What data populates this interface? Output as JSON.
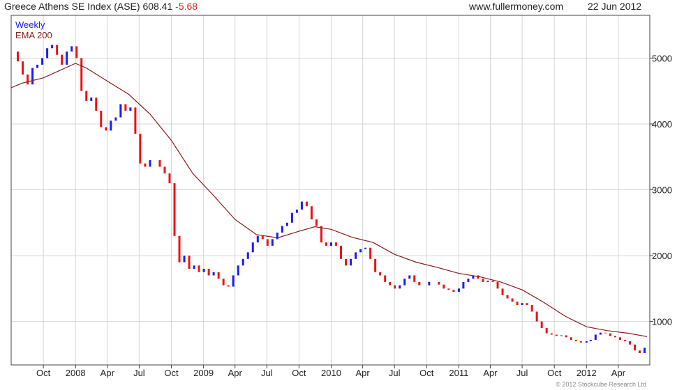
{
  "header": {
    "instrument": "Greece Athens SE Index (ASE)",
    "last": "608.41",
    "change": "-5.68",
    "source": "www.fullermoney.com",
    "date": "22 Jun 2012"
  },
  "copyright": "© 2012 Stockcube Research Ltd",
  "colors": {
    "up": "#1a1aff",
    "down": "#ee1111",
    "ema": "#8b1a1a",
    "grid": "#d6d6d6",
    "border": "#444444"
  },
  "chart_data": {
    "type": "line",
    "subtype": "candlestick-bars",
    "legend": [
      {
        "label": "Weekly",
        "color": "#1a1aff"
      },
      {
        "label": "EMA 200",
        "color": "#8b1a1a"
      }
    ],
    "legend_position": "top-left",
    "grid": true,
    "ylim": [
      340,
      5650
    ],
    "y_ticks": [
      1000,
      2000,
      3000,
      4000,
      5000
    ],
    "x_range": [
      "2007-07-01",
      "2012-06-30"
    ],
    "x_ticks": [
      {
        "label": "Oct",
        "date": "2007-10-01"
      },
      {
        "label": "2008",
        "date": "2008-01-01"
      },
      {
        "label": "Apr",
        "date": "2008-04-01"
      },
      {
        "label": "Jul",
        "date": "2008-07-01"
      },
      {
        "label": "Oct",
        "date": "2008-10-01"
      },
      {
        "label": "2009",
        "date": "2009-01-01"
      },
      {
        "label": "Apr",
        "date": "2009-04-01"
      },
      {
        "label": "Jul",
        "date": "2009-07-01"
      },
      {
        "label": "Oct",
        "date": "2009-10-01"
      },
      {
        "label": "2010",
        "date": "2010-01-01"
      },
      {
        "label": "Apr",
        "date": "2010-04-01"
      },
      {
        "label": "Jul",
        "date": "2010-07-01"
      },
      {
        "label": "Oct",
        "date": "2010-10-01"
      },
      {
        "label": "2011",
        "date": "2011-01-01"
      },
      {
        "label": "Apr",
        "date": "2011-04-01"
      },
      {
        "label": "Jul",
        "date": "2011-07-01"
      },
      {
        "label": "Oct",
        "date": "2011-10-01"
      },
      {
        "label": "2012",
        "date": "2012-01-01"
      },
      {
        "label": "Apr",
        "date": "2012-04-01"
      }
    ],
    "weekly_close": [
      [
        "2007-07-06",
        5100
      ],
      [
        "2007-07-20",
        4950
      ],
      [
        "2007-08-03",
        4750
      ],
      [
        "2007-08-17",
        4600
      ],
      [
        "2007-08-31",
        4850
      ],
      [
        "2007-09-14",
        4900
      ],
      [
        "2007-09-28",
        5000
      ],
      [
        "2007-10-12",
        5150
      ],
      [
        "2007-10-26",
        5200
      ],
      [
        "2007-11-09",
        5050
      ],
      [
        "2007-11-23",
        4900
      ],
      [
        "2007-12-07",
        5100
      ],
      [
        "2007-12-21",
        5180
      ],
      [
        "2008-01-04",
        5000
      ],
      [
        "2008-01-18",
        4500
      ],
      [
        "2008-02-01",
        4350
      ],
      [
        "2008-02-15",
        4400
      ],
      [
        "2008-02-29",
        4200
      ],
      [
        "2008-03-14",
        3950
      ],
      [
        "2008-03-28",
        3900
      ],
      [
        "2008-04-11",
        4050
      ],
      [
        "2008-04-25",
        4100
      ],
      [
        "2008-05-09",
        4300
      ],
      [
        "2008-05-23",
        4200
      ],
      [
        "2008-06-06",
        4250
      ],
      [
        "2008-06-20",
        3850
      ],
      [
        "2008-07-04",
        3400
      ],
      [
        "2008-07-18",
        3350
      ],
      [
        "2008-08-01",
        3450
      ],
      [
        "2008-08-15",
        3450
      ],
      [
        "2008-08-29",
        3350
      ],
      [
        "2008-09-12",
        3250
      ],
      [
        "2008-09-26",
        3100
      ],
      [
        "2008-10-10",
        2300
      ],
      [
        "2008-10-24",
        1900
      ],
      [
        "2008-11-07",
        2000
      ],
      [
        "2008-11-21",
        1800
      ],
      [
        "2008-12-05",
        1850
      ],
      [
        "2008-12-19",
        1750
      ],
      [
        "2009-01-02",
        1800
      ],
      [
        "2009-01-16",
        1700
      ],
      [
        "2009-01-30",
        1750
      ],
      [
        "2009-02-13",
        1650
      ],
      [
        "2009-02-27",
        1550
      ],
      [
        "2009-03-13",
        1530
      ],
      [
        "2009-03-27",
        1700
      ],
      [
        "2009-04-10",
        1850
      ],
      [
        "2009-04-24",
        1950
      ],
      [
        "2009-05-08",
        2050
      ],
      [
        "2009-05-22",
        2200
      ],
      [
        "2009-06-05",
        2300
      ],
      [
        "2009-06-19",
        2250
      ],
      [
        "2009-07-03",
        2150
      ],
      [
        "2009-07-17",
        2250
      ],
      [
        "2009-07-31",
        2350
      ],
      [
        "2009-08-14",
        2450
      ],
      [
        "2009-08-28",
        2500
      ],
      [
        "2009-09-11",
        2650
      ],
      [
        "2009-09-25",
        2700
      ],
      [
        "2009-10-09",
        2820
      ],
      [
        "2009-10-23",
        2750
      ],
      [
        "2009-11-06",
        2550
      ],
      [
        "2009-11-20",
        2450
      ],
      [
        "2009-12-04",
        2200
      ],
      [
        "2009-12-18",
        2150
      ],
      [
        "2010-01-01",
        2200
      ],
      [
        "2010-01-15",
        2150
      ],
      [
        "2010-01-29",
        1950
      ],
      [
        "2010-02-12",
        1850
      ],
      [
        "2010-02-26",
        1950
      ],
      [
        "2010-03-12",
        2050
      ],
      [
        "2010-03-26",
        2100
      ],
      [
        "2010-04-09",
        2120
      ],
      [
        "2010-04-23",
        1950
      ],
      [
        "2010-05-07",
        1750
      ],
      [
        "2010-05-21",
        1700
      ],
      [
        "2010-06-04",
        1600
      ],
      [
        "2010-06-18",
        1550
      ],
      [
        "2010-07-02",
        1500
      ],
      [
        "2010-07-16",
        1550
      ],
      [
        "2010-07-30",
        1650
      ],
      [
        "2010-08-13",
        1700
      ],
      [
        "2010-08-27",
        1600
      ],
      [
        "2010-09-10",
        1550
      ],
      [
        "2010-09-24",
        1550
      ],
      [
        "2010-10-08",
        1600
      ],
      [
        "2010-10-22",
        1600
      ],
      [
        "2010-11-05",
        1560
      ],
      [
        "2010-11-19",
        1500
      ],
      [
        "2010-12-03",
        1480
      ],
      [
        "2010-12-17",
        1450
      ],
      [
        "2011-01-01",
        1500
      ],
      [
        "2011-01-14",
        1600
      ],
      [
        "2011-01-28",
        1650
      ],
      [
        "2011-02-11",
        1700
      ],
      [
        "2011-02-25",
        1650
      ],
      [
        "2011-03-11",
        1600
      ],
      [
        "2011-03-25",
        1620
      ],
      [
        "2011-04-08",
        1600
      ],
      [
        "2011-04-22",
        1500
      ],
      [
        "2011-05-06",
        1400
      ],
      [
        "2011-05-20",
        1350
      ],
      [
        "2011-06-03",
        1300
      ],
      [
        "2011-06-17",
        1250
      ],
      [
        "2011-07-01",
        1280
      ],
      [
        "2011-07-15",
        1250
      ],
      [
        "2011-07-29",
        1150
      ],
      [
        "2011-08-12",
        1000
      ],
      [
        "2011-08-26",
        900
      ],
      [
        "2011-09-09",
        820
      ],
      [
        "2011-09-23",
        800
      ],
      [
        "2011-10-07",
        780
      ],
      [
        "2011-10-21",
        790
      ],
      [
        "2011-11-04",
        760
      ],
      [
        "2011-11-18",
        720
      ],
      [
        "2011-12-02",
        700
      ],
      [
        "2011-12-16",
        680
      ],
      [
        "2012-01-01",
        700
      ],
      [
        "2012-01-13",
        720
      ],
      [
        "2012-01-27",
        800
      ],
      [
        "2012-02-10",
        830
      ],
      [
        "2012-02-24",
        820
      ],
      [
        "2012-03-09",
        780
      ],
      [
        "2012-03-23",
        760
      ],
      [
        "2012-04-06",
        720
      ],
      [
        "2012-04-20",
        700
      ],
      [
        "2012-05-04",
        650
      ],
      [
        "2012-05-18",
        560
      ],
      [
        "2012-06-01",
        520
      ],
      [
        "2012-06-15",
        600
      ]
    ],
    "ema_200": [
      [
        "2007-07-01",
        4550
      ],
      [
        "2007-08-01",
        4620
      ],
      [
        "2007-10-01",
        4700
      ],
      [
        "2008-01-01",
        4920
      ],
      [
        "2008-02-01",
        4850
      ],
      [
        "2008-04-01",
        4650
      ],
      [
        "2008-06-01",
        4450
      ],
      [
        "2008-08-01",
        4150
      ],
      [
        "2008-10-01",
        3750
      ],
      [
        "2008-12-01",
        3250
      ],
      [
        "2009-02-01",
        2900
      ],
      [
        "2009-04-01",
        2550
      ],
      [
        "2009-06-01",
        2320
      ],
      [
        "2009-08-01",
        2270
      ],
      [
        "2009-10-01",
        2370
      ],
      [
        "2009-11-15",
        2440
      ],
      [
        "2010-01-01",
        2400
      ],
      [
        "2010-03-01",
        2280
      ],
      [
        "2010-05-01",
        2200
      ],
      [
        "2010-07-01",
        2020
      ],
      [
        "2010-09-01",
        1900
      ],
      [
        "2010-11-01",
        1820
      ],
      [
        "2011-01-01",
        1730
      ],
      [
        "2011-03-01",
        1680
      ],
      [
        "2011-05-01",
        1600
      ],
      [
        "2011-07-01",
        1480
      ],
      [
        "2011-09-01",
        1290
      ],
      [
        "2011-11-01",
        1080
      ],
      [
        "2012-01-01",
        920
      ],
      [
        "2012-03-01",
        860
      ],
      [
        "2012-05-01",
        820
      ],
      [
        "2012-06-22",
        770
      ]
    ]
  }
}
